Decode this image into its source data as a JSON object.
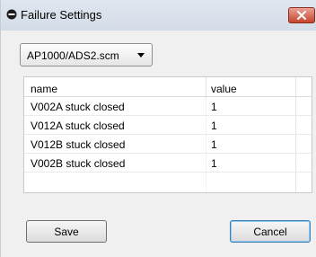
{
  "window": {
    "title": "Failure Settings"
  },
  "file_select": {
    "value": "AP1000/ADS2.scm"
  },
  "table": {
    "columns": [
      "name",
      "value"
    ],
    "rows": [
      {
        "name": "V002A stuck closed",
        "value": "1"
      },
      {
        "name": "V012A stuck closed",
        "value": "1"
      },
      {
        "name": "V012B stuck closed",
        "value": "1"
      },
      {
        "name": "V002B stuck closed",
        "value": "1"
      }
    ]
  },
  "buttons": {
    "save": "Save",
    "cancel": "Cancel"
  },
  "icons": {
    "title": "failure-settings-icon",
    "close": "close-icon",
    "dropdown": "dropdown-arrow-icon"
  }
}
